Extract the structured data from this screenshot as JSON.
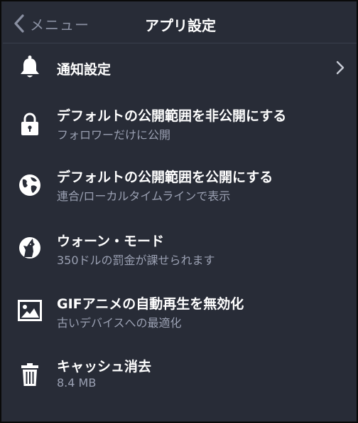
{
  "navbar": {
    "back_label": "メニュー",
    "title": "アプリ設定"
  },
  "settings": [
    {
      "icon": "bell-icon",
      "title": "通知設定",
      "subtitle": "",
      "has_chevron": true
    },
    {
      "icon": "lock-icon",
      "title": "デフォルトの公開範囲を非公開にする",
      "subtitle": "フォロワーだけに公開"
    },
    {
      "icon": "globe-icon",
      "title": "デフォルトの公開範囲を公開にする",
      "subtitle": "連合/ローカルタイムラインで表示"
    },
    {
      "icon": "howling-wolf-icon",
      "title": "ウォーン・モード",
      "subtitle": "350ドルの罰金が課せられます"
    },
    {
      "icon": "image-icon",
      "title": "GIFアニメの自動再生を無効化",
      "subtitle": "古いデバイスへの最適化"
    },
    {
      "icon": "trash-icon",
      "title": "キャッシュ消去",
      "subtitle": "8.4 MB"
    }
  ],
  "colors": {
    "background": "#282c37",
    "title_text": "#ffffff",
    "subtitle_text": "#9aa0b2",
    "back_text": "#8a90a2"
  }
}
